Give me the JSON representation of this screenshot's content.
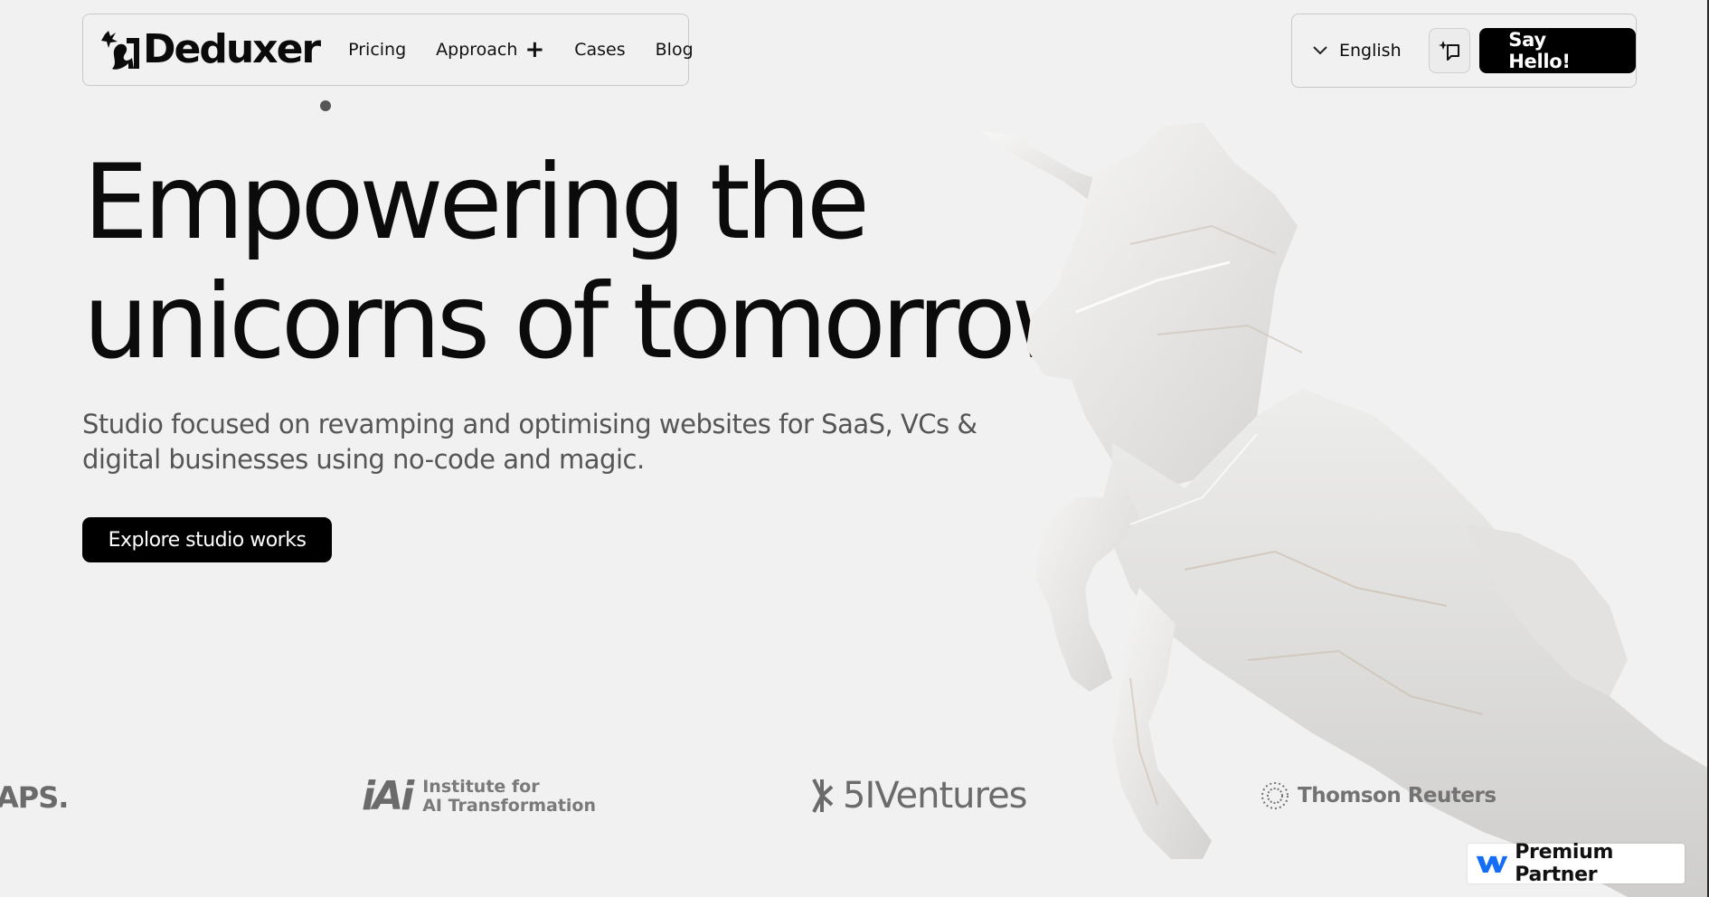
{
  "brand": {
    "name": "Deduxer"
  },
  "nav": {
    "links": [
      {
        "label": "Pricing"
      },
      {
        "label": "Approach"
      },
      {
        "label": "Cases"
      },
      {
        "label": "Blog"
      }
    ],
    "language": "English",
    "cta_label": "Say Hello!"
  },
  "hero": {
    "title_line1": "Empowering the",
    "title_line2": "unicorns of tomorrow",
    "subtitle_line1": "Studio focused on revamping and optimising websites for SaaS, VCs &",
    "subtitle_line2": "digital businesses using no-code and magic.",
    "cta_label": "Explore studio works"
  },
  "clients": {
    "aps": "APS.",
    "iai_mark": "iAi",
    "iai_line1": "Institute for",
    "iai_line2": "AI Transformation",
    "fivei": "5IVentures",
    "tr": "Thomson Reuters"
  },
  "badge": {
    "label": "Premium Partner",
    "icon": "webflow-icon",
    "color": "#146ef5"
  },
  "colors": {
    "background": "#f1f1f1",
    "primary_button": "#000000",
    "text": "#0b0b0b",
    "subtext": "#555555"
  }
}
